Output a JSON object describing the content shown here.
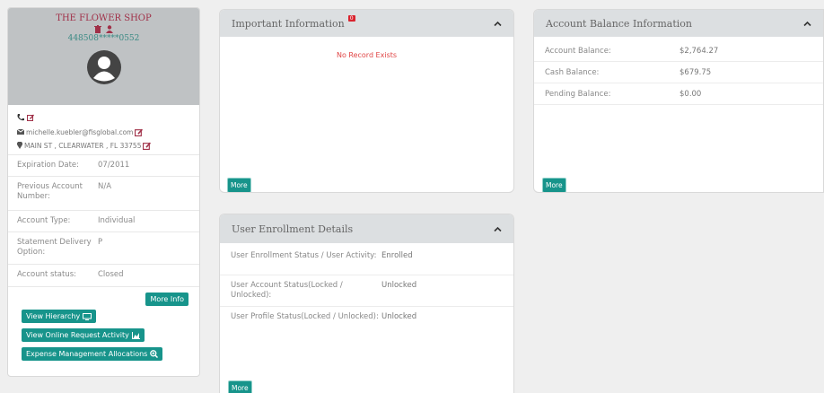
{
  "profile": {
    "shop_name": "THE FLOWER SHOP",
    "account_masked": "448508*****0552",
    "email": "michelle.kuebler@fisglobal.com",
    "address": "MAIN ST , CLEARWATER , FL 33755",
    "details": [
      {
        "label": "Expiration Date:",
        "value": "07/2011"
      },
      {
        "label": "Previous Account Number:",
        "value": "N/A"
      },
      {
        "label": "Account Type:",
        "value": "Individual"
      },
      {
        "label": "Statement Delivery Option:",
        "value": "P"
      },
      {
        "label": "Account status:",
        "value": "Closed"
      }
    ],
    "more_info_label": "More Info",
    "buttons": {
      "view_hierarchy": "View Hierarchy",
      "view_online_request": "View Online Request Activity",
      "expense_management": "Expense Management Allocations"
    }
  },
  "important": {
    "title": "Important Information",
    "badge": "0",
    "empty_text": "No Record Exists",
    "more_label": "More"
  },
  "balance": {
    "title": "Account Balance Information",
    "rows": [
      {
        "label": "Account Balance:",
        "value": "$2,764.27"
      },
      {
        "label": "Cash Balance:",
        "value": "$679.75"
      },
      {
        "label": "Pending Balance:",
        "value": "$0.00"
      }
    ],
    "more_label": "More"
  },
  "enrollment": {
    "title": "User Enrollment Details",
    "rows": [
      {
        "label": "User Enrollment Status / User Activity:",
        "value": "Enrolled"
      },
      {
        "label": "User Account Status(Locked / Unlocked):",
        "value": "Unlocked"
      },
      {
        "label": "User Profile Status(Locked / Unlocked):",
        "value": "Unlocked"
      }
    ],
    "more_label": "More"
  },
  "colors": {
    "accent": "#17948b",
    "brand": "#a03048",
    "header": "#dcdfe1"
  }
}
